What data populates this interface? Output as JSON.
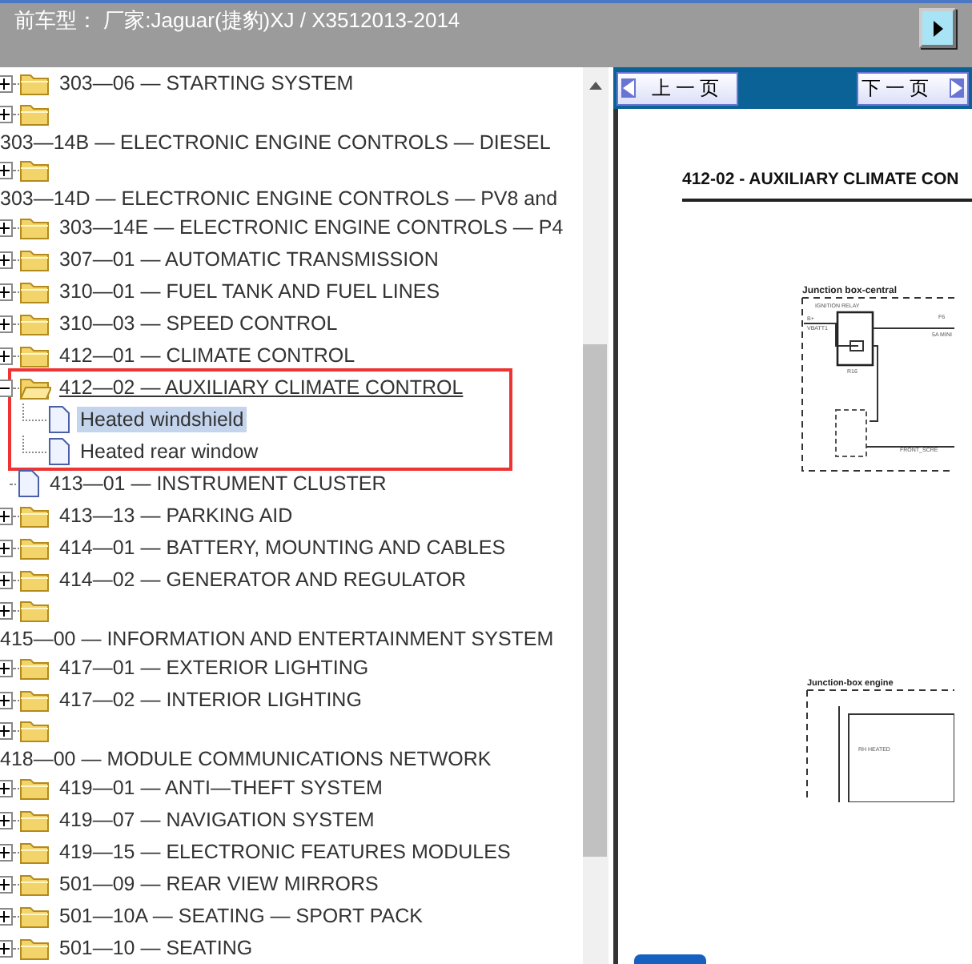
{
  "header": {
    "title": "前车型： 厂家:Jaguar(捷豹)XJ / X3512013-2014"
  },
  "tree": [
    {
      "label": "303—06 — STARTING SYSTEM",
      "kind": "folder",
      "expanded": false,
      "wrapped": false,
      "selected": false,
      "highlighted": false
    },
    {
      "label": "303—14B — ELECTRONIC ENGINE CONTROLS — DIESEL",
      "kind": "folder",
      "expanded": false,
      "wrapped": true,
      "selected": false,
      "highlighted": false
    },
    {
      "label": "303—14D — ELECTRONIC ENGINE CONTROLS — PV8 and",
      "kind": "folder",
      "expanded": false,
      "wrapped": true,
      "selected": false,
      "highlighted": false
    },
    {
      "label": "303—14E — ELECTRONIC ENGINE CONTROLS — P4",
      "kind": "folder",
      "expanded": false,
      "wrapped": false,
      "selected": false,
      "highlighted": false
    },
    {
      "label": "307—01 — AUTOMATIC TRANSMISSION",
      "kind": "folder",
      "expanded": false,
      "wrapped": false,
      "selected": false,
      "highlighted": false
    },
    {
      "label": "310—01 — FUEL TANK AND FUEL LINES",
      "kind": "folder",
      "expanded": false,
      "wrapped": false,
      "selected": false,
      "highlighted": false
    },
    {
      "label": "310—03 — SPEED CONTROL",
      "kind": "folder",
      "expanded": false,
      "wrapped": false,
      "selected": false,
      "highlighted": false
    },
    {
      "label": "412—01 — CLIMATE CONTROL",
      "kind": "folder",
      "expanded": false,
      "wrapped": false,
      "selected": false,
      "highlighted": false
    },
    {
      "label": "412—02 — AUXILIARY CLIMATE CONTROL",
      "kind": "folder",
      "expanded": true,
      "wrapped": false,
      "selected": false,
      "highlighted": true,
      "children": [
        {
          "label": "Heated windshield",
          "kind": "page",
          "selected": true
        },
        {
          "label": "Heated rear window",
          "kind": "page",
          "selected": false
        }
      ]
    },
    {
      "label": "413—01 — INSTRUMENT CLUSTER",
      "kind": "page",
      "wrapped": false,
      "selected": false,
      "highlighted": false
    },
    {
      "label": "413—13 — PARKING AID",
      "kind": "folder",
      "expanded": false,
      "wrapped": false,
      "selected": false,
      "highlighted": false
    },
    {
      "label": "414—01 — BATTERY, MOUNTING AND CABLES",
      "kind": "folder",
      "expanded": false,
      "wrapped": false,
      "selected": false,
      "highlighted": false
    },
    {
      "label": "414—02 — GENERATOR AND REGULATOR",
      "kind": "folder",
      "expanded": false,
      "wrapped": false,
      "selected": false,
      "highlighted": false
    },
    {
      "label": "415—00 — INFORMATION AND ENTERTAINMENT SYSTEM",
      "kind": "folder",
      "expanded": false,
      "wrapped": true,
      "selected": false,
      "highlighted": false
    },
    {
      "label": "417—01 — EXTERIOR LIGHTING",
      "kind": "folder",
      "expanded": false,
      "wrapped": false,
      "selected": false,
      "highlighted": false
    },
    {
      "label": "417—02 — INTERIOR LIGHTING",
      "kind": "folder",
      "expanded": false,
      "wrapped": false,
      "selected": false,
      "highlighted": false
    },
    {
      "label": "418—00 — MODULE COMMUNICATIONS NETWORK",
      "kind": "folder",
      "expanded": false,
      "wrapped": true,
      "selected": false,
      "highlighted": false
    },
    {
      "label": "419—01 — ANTI—THEFT SYSTEM",
      "kind": "folder",
      "expanded": false,
      "wrapped": false,
      "selected": false,
      "highlighted": false
    },
    {
      "label": "419—07 — NAVIGATION SYSTEM",
      "kind": "folder",
      "expanded": false,
      "wrapped": false,
      "selected": false,
      "highlighted": false
    },
    {
      "label": "419—15 — ELECTRONIC FEATURES MODULES",
      "kind": "folder",
      "expanded": false,
      "wrapped": false,
      "selected": false,
      "highlighted": false
    },
    {
      "label": "501—09 — REAR VIEW MIRRORS",
      "kind": "folder",
      "expanded": false,
      "wrapped": false,
      "selected": false,
      "highlighted": false
    },
    {
      "label": "501—10A — SEATING — SPORT PACK",
      "kind": "folder",
      "expanded": false,
      "wrapped": false,
      "selected": false,
      "highlighted": false
    },
    {
      "label": "501—10 — SEATING",
      "kind": "folder",
      "expanded": false,
      "wrapped": false,
      "selected": false,
      "highlighted": false
    }
  ],
  "viewer": {
    "prev_button": "上一页",
    "next_button": "下一页",
    "document": {
      "heading": "412-02 - AUXILIARY CLIMATE CON",
      "section_1": "Junction box-central",
      "relay_label": "IGNITION RELAY",
      "battery_labels": [
        "B+",
        "VBATT1"
      ],
      "fuse_labels": [
        "F6",
        "5A MINI"
      ],
      "relay_code": "R16",
      "wire_label": "FRONT_SCRE",
      "section_2": "Junction-box engine",
      "screen_label": "RH HEATED"
    }
  }
}
